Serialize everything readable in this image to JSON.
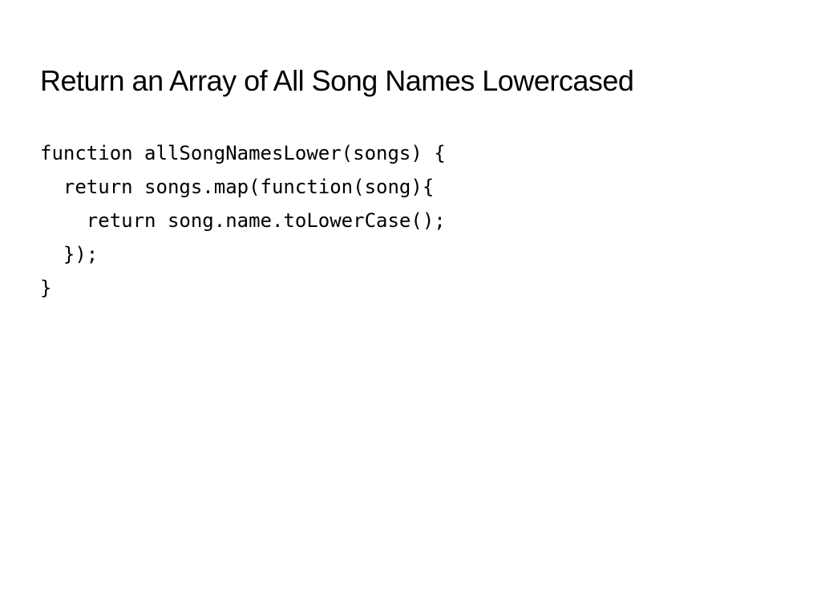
{
  "slide": {
    "title": "Return an Array of All Song Names Lowercased",
    "code": "function allSongNamesLower(songs) {\n  return songs.map(function(song){\n    return song.name.toLowerCase();\n  });\n}"
  }
}
